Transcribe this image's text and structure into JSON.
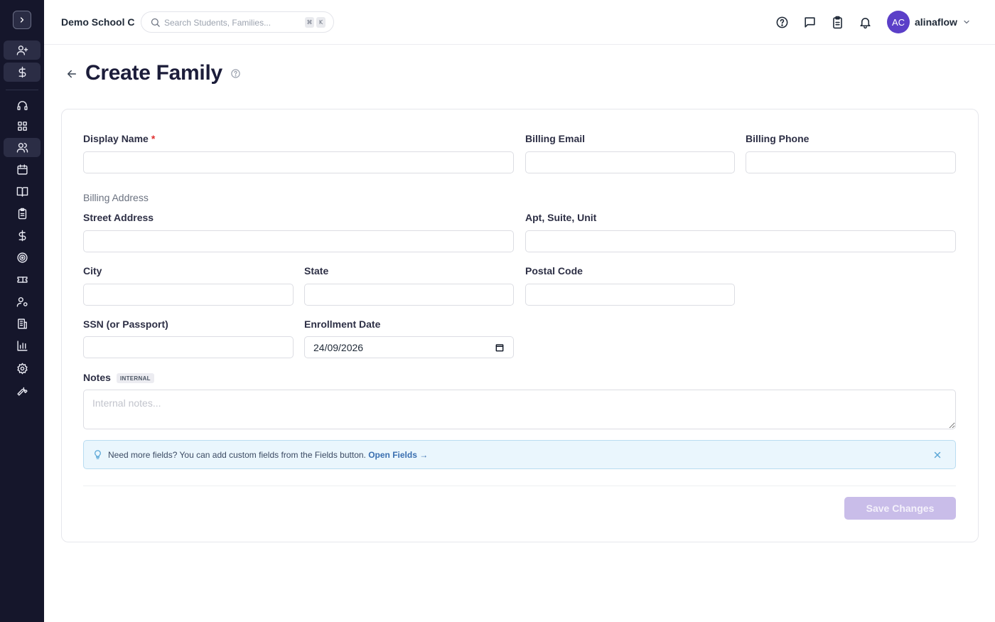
{
  "sidebar": {
    "items": [
      {
        "icon": "user-plus-icon"
      },
      {
        "icon": "dollar-icon"
      },
      {
        "icon": "headset-icon"
      },
      {
        "icon": "dashboard-grid-icon"
      },
      {
        "icon": "users-icon",
        "active": true
      },
      {
        "icon": "calendar-icon"
      },
      {
        "icon": "book-icon"
      },
      {
        "icon": "clipboard-icon"
      },
      {
        "icon": "dollar-icon"
      },
      {
        "icon": "target-icon"
      },
      {
        "icon": "ticket-icon"
      },
      {
        "icon": "user-cog-icon"
      },
      {
        "icon": "building-icon"
      },
      {
        "icon": "bar-chart-icon"
      },
      {
        "icon": "gear-icon"
      },
      {
        "icon": "wrench-icon"
      }
    ]
  },
  "header": {
    "school_name": "Demo School C",
    "search_placeholder": "Search Students, Families...",
    "shortcut_keys": [
      "⌘",
      "K"
    ],
    "username": "alinaflow",
    "avatar_initials": "AC",
    "avatar_color": "#5b3fc8"
  },
  "page": {
    "title": "Create Family"
  },
  "form": {
    "display_name_label": "Display Name",
    "required_mark": "*",
    "billing_email_label": "Billing Email",
    "billing_phone_label": "Billing Phone",
    "billing_address_section": "Billing Address",
    "street_address_label": "Street Address",
    "apt_label": "Apt, Suite, Unit",
    "city_label": "City",
    "state_label": "State",
    "postal_code_label": "Postal Code",
    "ssn_label": "SSN (or Passport)",
    "enrollment_date_label": "Enrollment Date",
    "enrollment_date_value": "24/09/2026",
    "notes_label": "Notes",
    "notes_badge": "INTERNAL",
    "notes_placeholder": "Internal notes...",
    "tip_text": "Need more fields? You can add custom fields from the Fields button.",
    "tip_link": "Open Fields →",
    "save_label": "Save Changes"
  },
  "colors": {
    "sidebar_bg": "#15162b",
    "accent": "#5b3fc8",
    "save_disabled": "#c9bde9",
    "tip_bg": "#eaf6fd",
    "required": "#e03131"
  }
}
